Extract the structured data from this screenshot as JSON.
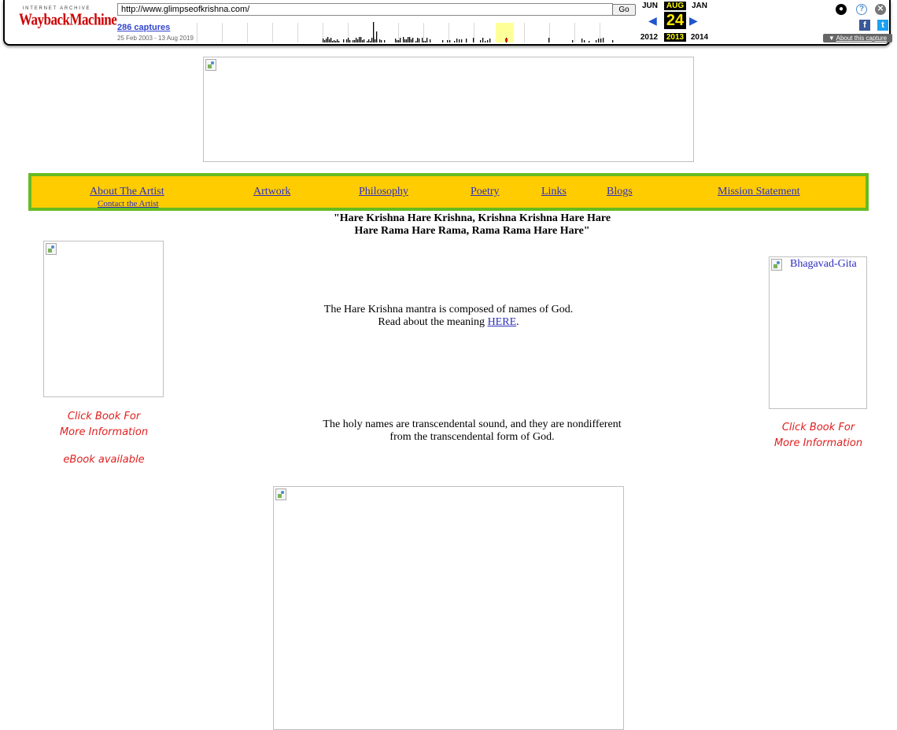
{
  "wayback": {
    "logo_top": "INTERNET ARCHIVE",
    "logo_main": "WaybackMachine",
    "url": "http://www.glimpseofkrishna.com/",
    "go_label": "Go",
    "captures": "286 captures",
    "date_range": "25 Feb 2003 - 13 Aug 2019",
    "months": {
      "prev": "JUN",
      "current": "AUG",
      "next": "JAN"
    },
    "day": "24",
    "years": {
      "prev": "2012",
      "current": "2013",
      "next": "2014"
    },
    "about_label": "About this capture",
    "colors": {
      "accent": "#ffe900",
      "logo": "#cc0000",
      "link": "#3344cc"
    }
  },
  "nav": {
    "items": [
      {
        "label": "About The Artist"
      },
      {
        "label": "Artwork"
      },
      {
        "label": "Philosophy"
      },
      {
        "label": "Poetry"
      },
      {
        "label": "Links"
      },
      {
        "label": "Blogs"
      },
      {
        "label": "Mission Statement"
      }
    ],
    "contact_label": "Contact the Artist",
    "colors": {
      "background": "#ffcc00",
      "border": "#66bb22"
    }
  },
  "mantra": {
    "line1": "\"Hare Krishna Hare Krishna, Krishna Krishna Hare Hare",
    "line2": "Hare Rama Hare Rama, Rama Rama Hare Hare\""
  },
  "intro": {
    "line1": "The Hare Krishna mantra is composed of names of God.",
    "line2_prefix": "Read about the meaning ",
    "link": "HERE",
    "line2_suffix": "."
  },
  "holy_names": {
    "line1": "The holy names are transcendental sound, and they are nondifferent",
    "line2": "from the transcendental form of God."
  },
  "left_book": {
    "caption1": "Click Book For",
    "caption2": "More Information",
    "ebook": "eBook available"
  },
  "right_book": {
    "alt": "Bhagavad-Gita",
    "caption1": "Click Book For",
    "caption2": "More Information"
  }
}
